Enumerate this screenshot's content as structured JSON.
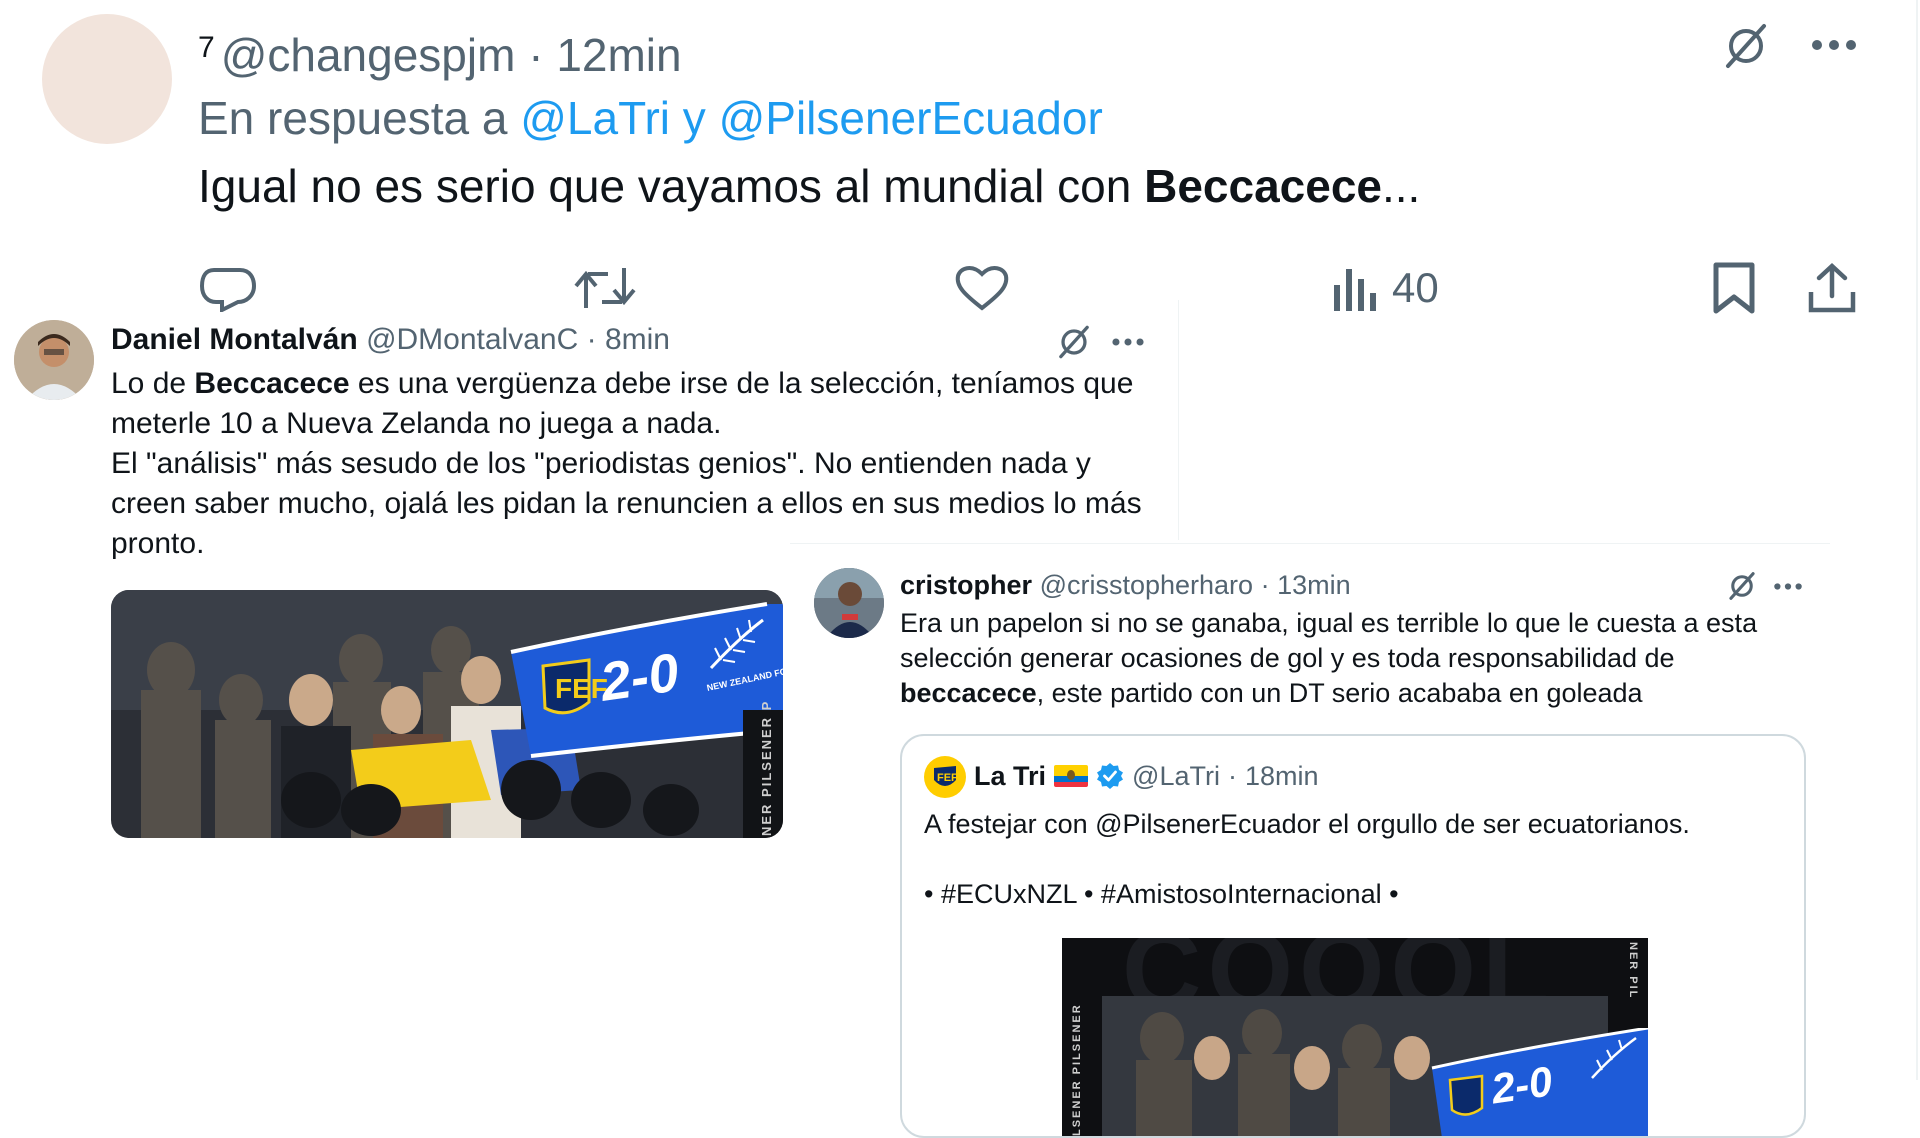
{
  "colors": {
    "accent": "#1d9bf0",
    "muted": "#536471",
    "text": "#0f1419",
    "verified": "#1d9bf0",
    "banner_blue": "#1e5bd8"
  },
  "tweet1": {
    "thread_count": "7",
    "handle": "@changespjm",
    "separator": "·",
    "time": "12min",
    "reply_prefix": "En respuesta a",
    "reply_to_1": "@LaTri",
    "reply_conj": "y",
    "reply_to_2": "@PilsenerEcuador",
    "text_before": "Igual no es serio que vayamos al mundial con ",
    "text_bold": "Beccacece",
    "text_after": "...",
    "views": "40",
    "icons": [
      "grok-icon",
      "more-icon",
      "reply-icon",
      "retweet-icon",
      "like-icon",
      "views-icon",
      "bookmark-icon",
      "share-icon"
    ]
  },
  "tweet2": {
    "name": "Daniel Montalván",
    "handle": "@DMontalvanC",
    "separator": "·",
    "time": "8min",
    "line1_a": "Lo de ",
    "line1_bold": "Beccacece",
    "line1_b": " es una vergüenza debe irse de la selección, teníamos que meterle 10 a Nueva Zelanda no juega a nada.",
    "line2": "El \"análisis\" más sesudo de los \"periodistas genios\". No entienden nada y creen saber mucho, ojalá les pidan la renuncien a ellos en sus medios lo más pronto.",
    "media": {
      "score": "2-0",
      "side_text": "NER PILSENER P",
      "badge_text": "NEW ZEALAND FOOTBALL"
    }
  },
  "tweet3": {
    "name": "cristopher",
    "handle": "@crisstopherharo",
    "separator": "·",
    "time": "13min",
    "text_a": "Era un papelon si no se ganaba, igual es terrible lo que le cuesta a esta selección generar ocasiones de gol y es toda responsabilidad de ",
    "text_bold": "beccacece",
    "text_b": ", este partido con un DT serio acababa en goleada"
  },
  "quote": {
    "name": "La Tri",
    "handle": "@LaTri",
    "separator": "·",
    "time": "18min",
    "text1": "A festejar con @PilsenerEcuador el orgullo de ser ecuatorianos.",
    "text2": "• #ECUxNZL •  #AmistosoInternacional •",
    "media": {
      "score": "2-0",
      "side_left": "LSENER PILSENER",
      "side_right": "NER PIL"
    }
  }
}
